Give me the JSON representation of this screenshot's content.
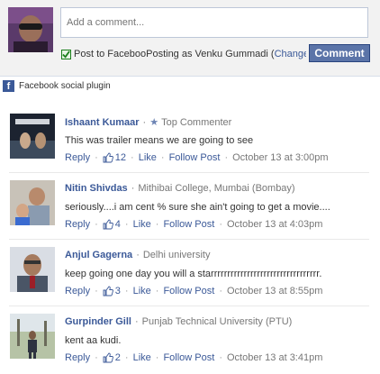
{
  "composer": {
    "placeholder": "Add a comment...",
    "post_to_label": "Post to Faceboo",
    "posting_as": "Posting as Venku Gummadi",
    "change_link": "Change",
    "comment_button": "Comment",
    "checkbox_checked": true
  },
  "plugin": {
    "label": "Facebook social plugin"
  },
  "colors": {
    "link": "#3b5998",
    "button": "#5b74a8",
    "meta": "#777777"
  },
  "comments": [
    {
      "name": "Ishaant Kumaar",
      "badge": "Top Commenter",
      "text": "This was trailer means we are going to see",
      "like_count": "12",
      "reply": "Reply",
      "like": "Like",
      "follow": "Follow Post",
      "timestamp": "October 13 at 3:00pm"
    },
    {
      "name": "Nitin Shivdas",
      "affiliation": "Mithibai College, Mumbai (Bombay)",
      "text": "seriously....i am cent % sure she ain't going to get a movie....",
      "like_count": "4",
      "reply": "Reply",
      "like": "Like",
      "follow": "Follow Post",
      "timestamp": "October 13 at 4:03pm"
    },
    {
      "name": "Anjul Gagerna",
      "affiliation": "Delhi university",
      "text": "keep going one day you will a starrrrrrrrrrrrrrrrrrrrrrrrrrrrrrrrr.",
      "like_count": "3",
      "reply": "Reply",
      "like": "Like",
      "follow": "Follow Post",
      "timestamp": "October 13 at 8:55pm"
    },
    {
      "name": "Gurpinder Gill",
      "affiliation": "Punjab Technical University (PTU)",
      "text": "kent aa kudi.",
      "like_count": "2",
      "reply": "Reply",
      "like": "Like",
      "follow": "Follow Post",
      "timestamp": "October 13 at 3:41pm"
    }
  ]
}
